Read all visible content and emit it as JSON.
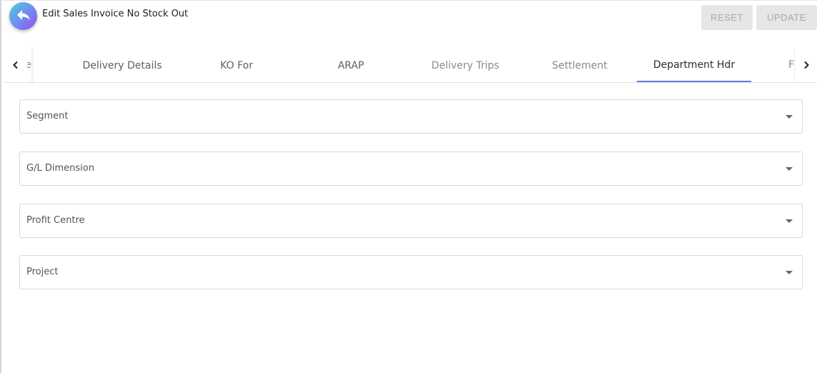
{
  "header": {
    "title": "Edit Sales Invoice No Stock Out",
    "reset_label": "RESET",
    "update_label": "UPDATE",
    "back_icon": "back-arrow-icon"
  },
  "tabs": {
    "clipped_left": "e",
    "items": [
      {
        "label": "Delivery Details"
      },
      {
        "label": "KO For"
      },
      {
        "label": "ARAP"
      },
      {
        "label": "Delivery Trips"
      },
      {
        "label": "Settlement"
      },
      {
        "label": "Department Hdr"
      }
    ],
    "clipped_right": "F",
    "active_index": 5,
    "prev_icon": "chevron-left-icon",
    "next_icon": "chevron-right-icon",
    "active_indicator_color": "#6a7ad6"
  },
  "form": {
    "fields": [
      {
        "label": "Segment",
        "value": ""
      },
      {
        "label": "G/L Dimension",
        "value": ""
      },
      {
        "label": "Profit Centre",
        "value": ""
      },
      {
        "label": "Project",
        "value": ""
      }
    ]
  }
}
